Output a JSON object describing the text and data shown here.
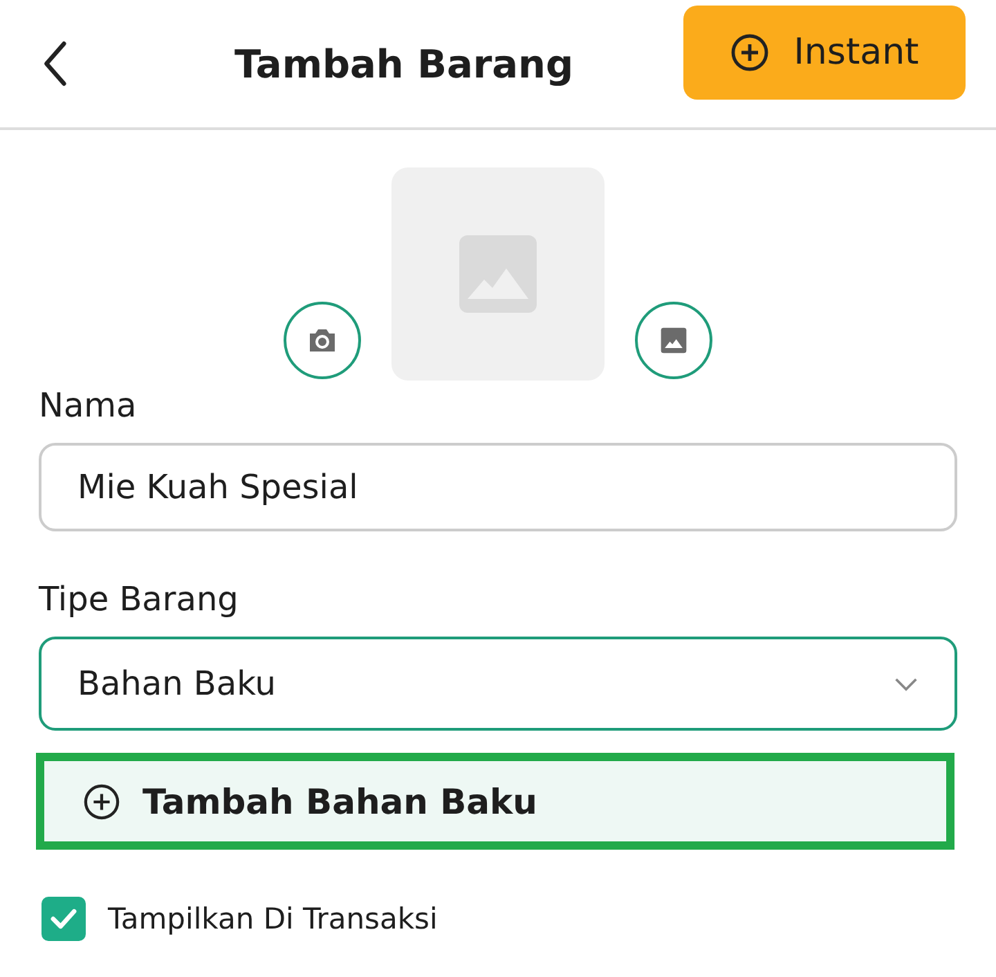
{
  "header": {
    "title": "Tambah Barang",
    "instant_button": "Instant"
  },
  "fields": [
    {
      "kind": "input",
      "label": "Nama",
      "value": "Mie Kuah Spesial"
    },
    {
      "kind": "select",
      "label": "Tipe Barang",
      "value": "Bahan Baku"
    }
  ],
  "add_button": "Tambah Bahan Baku",
  "show_in_transactions": {
    "label": "Tampilkan Di Transaksi",
    "checked": true
  }
}
